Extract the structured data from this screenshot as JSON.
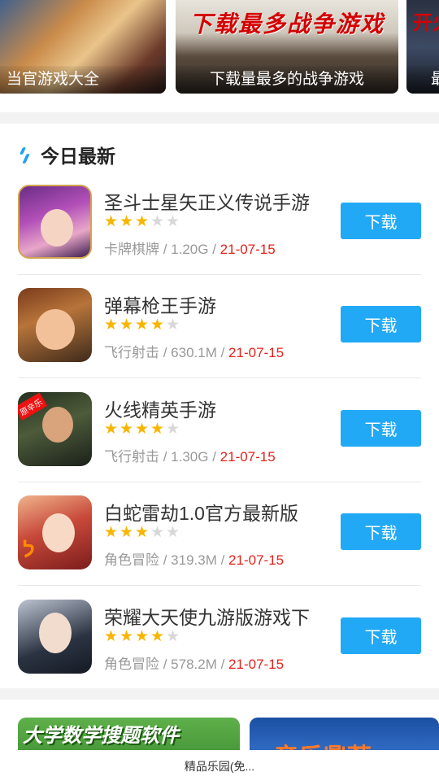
{
  "banners": [
    {
      "caption": "当官游戏大全",
      "art_title": ""
    },
    {
      "caption": "下载量最多的战争游戏",
      "art_title": "下载最多战争游戏"
    },
    {
      "caption": "最",
      "art_title": "开火"
    }
  ],
  "section": {
    "title": "今日最新",
    "icon": "lightning-icon"
  },
  "apps": [
    {
      "name": "圣斗士星矢正义传说手游",
      "rating": 3,
      "category": "卡牌棋牌",
      "size": "1.20G",
      "date": "21-07-15",
      "button": "下载"
    },
    {
      "name": "弹幕枪王手游",
      "rating": 4,
      "category": "飞行射击",
      "size": "630.1M",
      "date": "21-07-15",
      "button": "下载"
    },
    {
      "name": "火线精英手游",
      "rating": 4,
      "category": "飞行射击",
      "size": "1.30G",
      "date": "21-07-15",
      "button": "下载"
    },
    {
      "name": "白蛇雷劫1.0官方最新版",
      "rating": 3,
      "category": "角色冒险",
      "size": "319.3M",
      "date": "21-07-15",
      "button": "下载"
    },
    {
      "name": "荣耀大天使九游版游戏下",
      "rating": 4,
      "category": "角色冒险",
      "size": "578.2M",
      "date": "21-07-15",
      "button": "下载"
    }
  ],
  "icon3_tag": "原辛乐",
  "bottom_banners": [
    {
      "art_title": "大学数学搜题软件"
    },
    {
      "art_title": "音乐鼎荐"
    }
  ],
  "footer": {
    "text": "精品乐园(免..."
  },
  "colors": {
    "accent": "#21a9f5",
    "star": "#f7b500",
    "date": "#e6211c"
  }
}
